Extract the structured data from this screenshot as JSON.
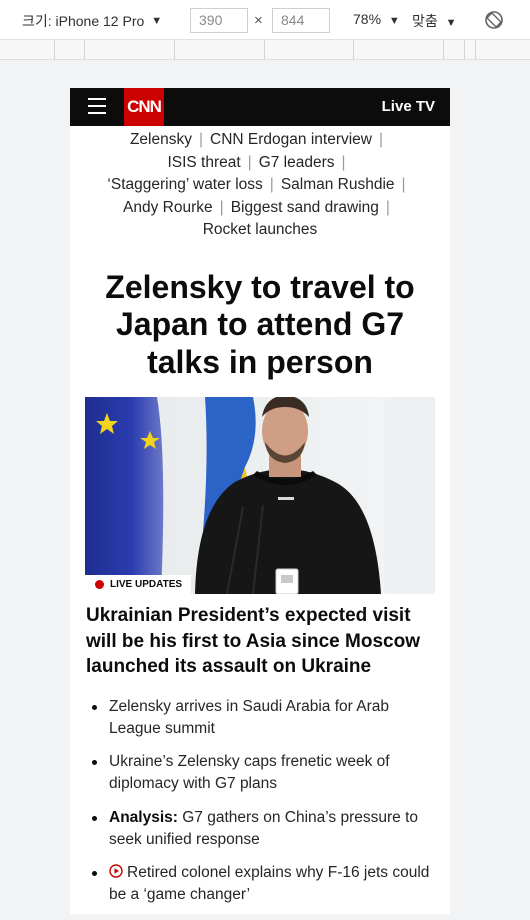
{
  "devtools": {
    "device_label": "크기: iPhone 12 Pro",
    "width": "390",
    "height": "844",
    "zoom": "78%",
    "fit_label": "맞춤"
  },
  "header": {
    "logo": "CNN",
    "live_tv": "Live TV"
  },
  "trending": [
    [
      "Zelensky",
      "CNN Erdogan interview"
    ],
    [
      "ISIS threat",
      "G7 leaders"
    ],
    [
      "‘Staggering’ water loss",
      "Salman Rushdie"
    ],
    [
      "Andy Rourke",
      "Biggest sand drawing"
    ],
    [
      "Rocket launches"
    ]
  ],
  "headline": "Zelensky to travel to Japan to attend G7 talks in person",
  "hero": {
    "badge": "LIVE UPDATES"
  },
  "subhead": "Ukrainian President’s expected visit will be his first to Asia since Moscow launched its assault on Ukraine",
  "bullets": [
    {
      "prefix": "",
      "text": "Zelensky arrives in Saudi Arabia for Arab League summit"
    },
    {
      "prefix": "",
      "text": "Ukraine’s Zelensky caps frenetic week of diplomacy with G7 plans"
    },
    {
      "prefix": "Analysis:",
      "text": " G7 gathers on China’s pressure to seek unified response"
    },
    {
      "prefix": "",
      "text": "Retired colonel explains why F-16 jets could be a ‘game changer’"
    }
  ],
  "colors": {
    "cnn_red": "#cc0000",
    "header_black": "#0c0c0c"
  }
}
